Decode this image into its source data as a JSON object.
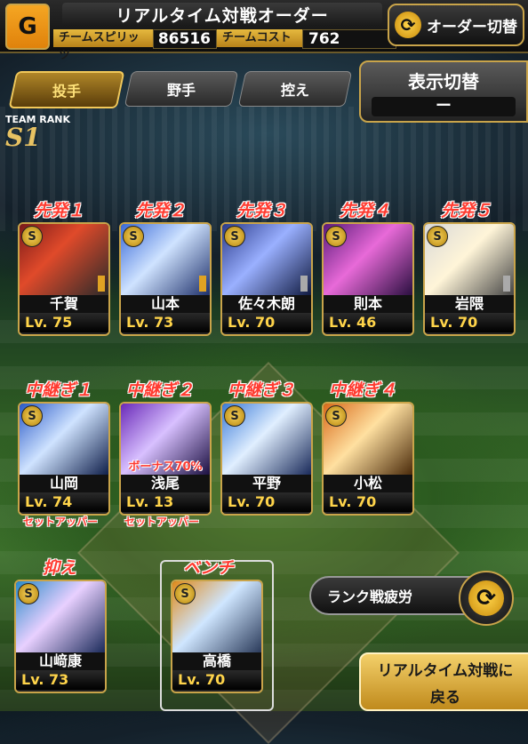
{
  "header": {
    "title": "リアルタイム対戦オーダー",
    "logo_text": "G",
    "team_spirit_label": "チームスピリッツ",
    "team_spirit_value": "86516",
    "team_cost_label": "チームコスト",
    "team_cost_value": "762",
    "order_switch_label": "オーダー切替"
  },
  "tabs": [
    "投手",
    "野手",
    "控え"
  ],
  "active_tab": 0,
  "display_switch": {
    "title": "表示切替",
    "value": "ー"
  },
  "team_rank": {
    "label": "TEAM RANK",
    "value": "S1"
  },
  "starters": [
    {
      "slot": "先発１",
      "name": "千賀",
      "level": "Lv. 75",
      "chip": "gold"
    },
    {
      "slot": "先発２",
      "name": "山本",
      "level": "Lv. 73",
      "chip": "gold"
    },
    {
      "slot": "先発３",
      "name": "佐々木朗",
      "level": "Lv. 70",
      "chip": "grey"
    },
    {
      "slot": "先発４",
      "name": "則本",
      "level": "Lv. 46",
      "chip": ""
    },
    {
      "slot": "先発５",
      "name": "岩隈",
      "level": "Lv. 70",
      "chip": "grey"
    }
  ],
  "relievers": [
    {
      "slot": "中継ぎ１",
      "name": "山岡",
      "level": "Lv. 74",
      "note": "セットアッパー"
    },
    {
      "slot": "中継ぎ２",
      "name": "浅尾",
      "level": "Lv. 13",
      "note": "セットアッパー",
      "bonus": "ボーナス70%"
    },
    {
      "slot": "中継ぎ３",
      "name": "平野",
      "level": "Lv. 70",
      "note": ""
    },
    {
      "slot": "中継ぎ４",
      "name": "小松",
      "level": "Lv. 70",
      "note": ""
    }
  ],
  "closer": {
    "slot": "抑え",
    "name": "山﨑康",
    "level": "Lv. 73"
  },
  "bench": {
    "slot": "ベンチ",
    "name": "高橋",
    "level": "Lv. 70"
  },
  "fatigue_label": "ランク戦疲労",
  "return_button": {
    "line1": "リアルタイム対戦に",
    "line2": "戻る"
  },
  "colors": {
    "accent": "#c9a44a",
    "slot_label": "#ff3b30",
    "level": "#ffd44a"
  }
}
